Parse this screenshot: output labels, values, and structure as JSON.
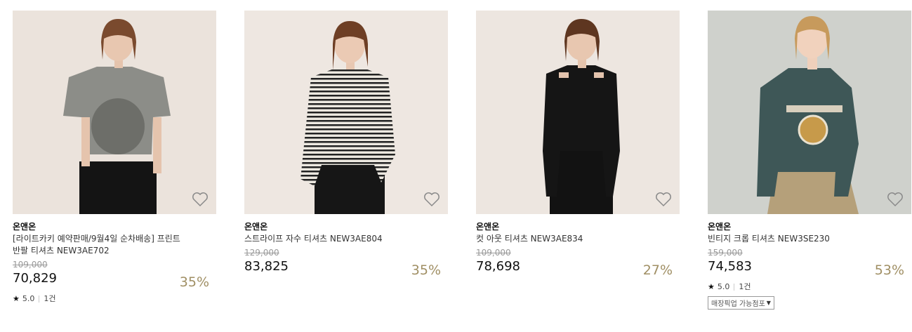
{
  "products": [
    {
      "brand": "온앤온",
      "title": "[라이트카키 예약판매/9월4일 순차배송] 프린트 반팔 티셔츠 NEW3AE702",
      "original_price": "109,000",
      "sale_price": "70,829",
      "discount": "35%",
      "rating": "5.0",
      "review_count": "1건",
      "store_button": null,
      "bg_color": "#ebe3dc",
      "wishlist_icon": "heart-outline-icon"
    },
    {
      "brand": "온앤온",
      "title": "스트라이프 자수 티셔츠 NEW3AE804",
      "original_price": "129,000",
      "sale_price": "83,825",
      "discount": "35%",
      "rating": null,
      "review_count": null,
      "store_button": null,
      "bg_color": "#eee7e1",
      "wishlist_icon": "heart-outline-icon"
    },
    {
      "brand": "온앤온",
      "title": "컷 아웃 티셔츠 NEW3AE834",
      "original_price": "109,000",
      "sale_price": "78,698",
      "discount": "27%",
      "rating": null,
      "review_count": null,
      "store_button": null,
      "bg_color": "#ede6e0",
      "wishlist_icon": "heart-outline-icon"
    },
    {
      "brand": "온앤온",
      "title": "빈티지 크롭 티셔츠 NEW3SE230",
      "original_price": "159,000",
      "sale_price": "74,583",
      "discount": "53%",
      "rating": "5.0",
      "review_count": "1건",
      "store_button": "매장픽업 가능점포",
      "bg_color": "#cfd1cc",
      "wishlist_icon": "heart-outline-icon"
    }
  ],
  "colors": {
    "discount": "#a08f64",
    "strike": "#999999"
  }
}
